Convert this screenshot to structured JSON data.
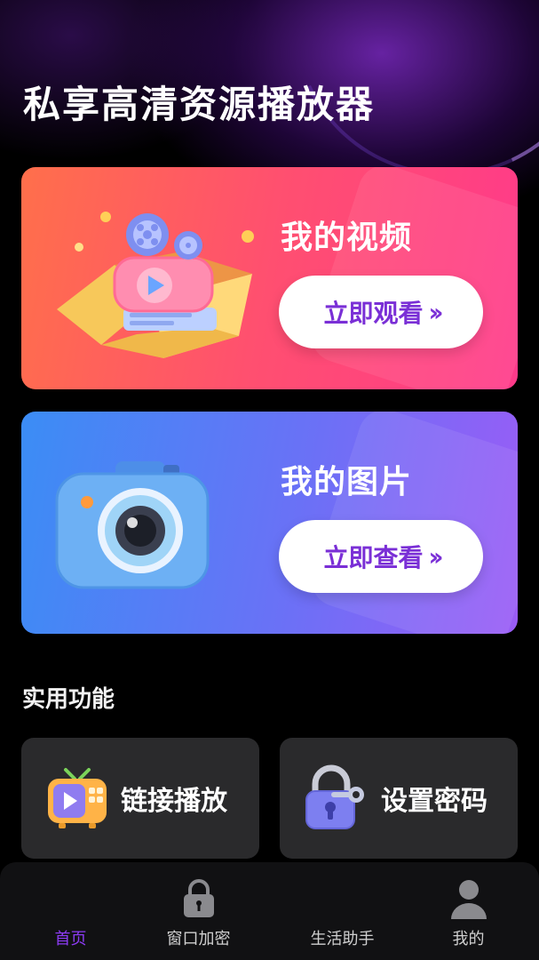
{
  "app": {
    "title": "私享高清资源播放器"
  },
  "cards": [
    {
      "title": "我的视频",
      "button_label": "立即观看",
      "chevron": "››",
      "icon": "film-projector-icon"
    },
    {
      "title": "我的图片",
      "button_label": "立即查看",
      "chevron": "››",
      "icon": "camera-icon"
    }
  ],
  "section": {
    "title": "实用功能"
  },
  "tools": [
    {
      "label": "链接播放",
      "icon": "tv-play-icon"
    },
    {
      "label": "设置密码",
      "icon": "padlock-key-icon"
    }
  ],
  "tabbar": {
    "items": [
      {
        "label": "首页",
        "active": true,
        "icon": ""
      },
      {
        "label": "窗口加密",
        "active": false,
        "icon": "lock-icon"
      },
      {
        "label": "生活助手",
        "active": false,
        "icon": ""
      },
      {
        "label": "我的",
        "active": false,
        "icon": "person-icon"
      }
    ]
  },
  "colors": {
    "accent": "#8d3cf5",
    "video_card_start": "#ff6f4b",
    "video_card_end": "#ff3a8a",
    "photo_card_start": "#3b8df5",
    "photo_card_end": "#9a5cf6",
    "tile_bg": "#2a2a2c"
  }
}
